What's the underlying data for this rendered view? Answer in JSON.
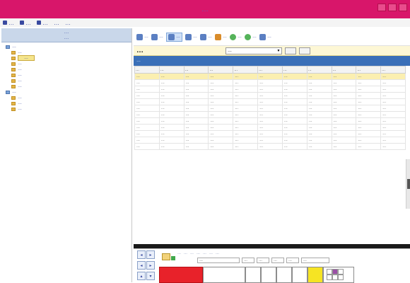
{
  "window": {
    "title": "…"
  },
  "menubar": {
    "items": [
      "…",
      "…",
      "…",
      "…",
      "…"
    ]
  },
  "leftpane": {
    "header_line1": "…",
    "header_line2": "…",
    "tree": [
      {
        "label": "…",
        "level": 0,
        "root": true,
        "selected": false
      },
      {
        "label": "…",
        "level": 1,
        "root": false,
        "selected": false
      },
      {
        "label": "…",
        "level": 1,
        "root": false,
        "selected": true
      },
      {
        "label": "…",
        "level": 1,
        "root": false,
        "selected": false
      },
      {
        "label": "…",
        "level": 1,
        "root": false,
        "selected": false
      },
      {
        "label": "…",
        "level": 1,
        "root": false,
        "selected": false
      },
      {
        "label": "…",
        "level": 1,
        "root": false,
        "selected": false
      },
      {
        "label": "…",
        "level": 1,
        "root": false,
        "selected": false
      },
      {
        "label": "…",
        "level": 0,
        "root": true,
        "selected": false
      },
      {
        "label": "…",
        "level": 1,
        "root": false,
        "selected": false
      },
      {
        "label": "…",
        "level": 1,
        "root": false,
        "selected": false
      },
      {
        "label": "…",
        "level": 1,
        "root": false,
        "selected": false
      }
    ]
  },
  "toolbar": {
    "items": [
      {
        "label": "…",
        "icon": "add-icon"
      },
      {
        "label": "…",
        "icon": "delete-icon"
      },
      {
        "label": "…",
        "icon": "filter-icon",
        "active": true
      },
      {
        "label": "…",
        "icon": "settings-icon"
      },
      {
        "label": "…",
        "icon": "refresh-icon"
      },
      {
        "label": "…",
        "icon": "edit-icon"
      },
      {
        "label": "…",
        "icon": "green-circle-icon"
      },
      {
        "label": "…",
        "icon": "green-circle-icon"
      },
      {
        "label": "…",
        "icon": "close-icon"
      }
    ]
  },
  "main": {
    "page_title": "…",
    "combo_value": "…",
    "info_text": "…",
    "table": {
      "headers": [
        "…",
        "…",
        "…",
        "…",
        "…",
        "…",
        "…",
        "…",
        "…",
        "…",
        "…"
      ],
      "rows": [
        [
          "…",
          "…",
          "…",
          "…",
          "…",
          "…",
          "…",
          "…",
          "…",
          "…",
          "…"
        ],
        [
          "…",
          "…",
          "…",
          "…",
          "…",
          "…",
          "…",
          "…",
          "…",
          "…",
          "…"
        ],
        [
          "…",
          "…",
          "…",
          "…",
          "…",
          "…",
          "…",
          "…",
          "…",
          "…",
          "…"
        ],
        [
          "…",
          "…",
          "…",
          "…",
          "…",
          "…",
          "…",
          "…",
          "…",
          "…",
          "…"
        ],
        [
          "…",
          "…",
          "…",
          "…",
          "…",
          "…",
          "…",
          "…",
          "…",
          "…",
          "…"
        ],
        [
          "…",
          "…",
          "…",
          "…",
          "…",
          "…",
          "…",
          "…",
          "…",
          "…",
          "…"
        ],
        [
          "…",
          "…",
          "…",
          "…",
          "…",
          "…",
          "…",
          "…",
          "…",
          "…",
          "…"
        ],
        [
          "…",
          "…",
          "…",
          "…",
          "…",
          "…",
          "…",
          "…",
          "…",
          "…",
          "…"
        ],
        [
          "…",
          "…",
          "…",
          "…",
          "…",
          "…",
          "…",
          "…",
          "…",
          "…",
          "…"
        ],
        [
          "…",
          "…",
          "…",
          "…",
          "…",
          "…",
          "…",
          "…",
          "…",
          "…",
          "…"
        ],
        [
          "…",
          "…",
          "…",
          "…",
          "…",
          "…",
          "…",
          "…",
          "…",
          "…",
          "…"
        ],
        [
          "…",
          "…",
          "…",
          "…",
          "…",
          "…",
          "…",
          "…",
          "…",
          "…",
          "…"
        ]
      ]
    }
  },
  "bottom": {
    "labels": [
      "…",
      "…",
      "…",
      "…",
      "…",
      "…",
      "…"
    ],
    "fields": [
      "…",
      "…",
      "…",
      "…",
      "…",
      "…"
    ]
  },
  "colors": {
    "titlebar": "#d8166a",
    "selection": "#f5e58c",
    "info_bar": "#3a6fb8",
    "swatch_red": "#e8222a",
    "swatch_yellow": "#f6e423",
    "swatch_purple": "#9b4fa6"
  }
}
